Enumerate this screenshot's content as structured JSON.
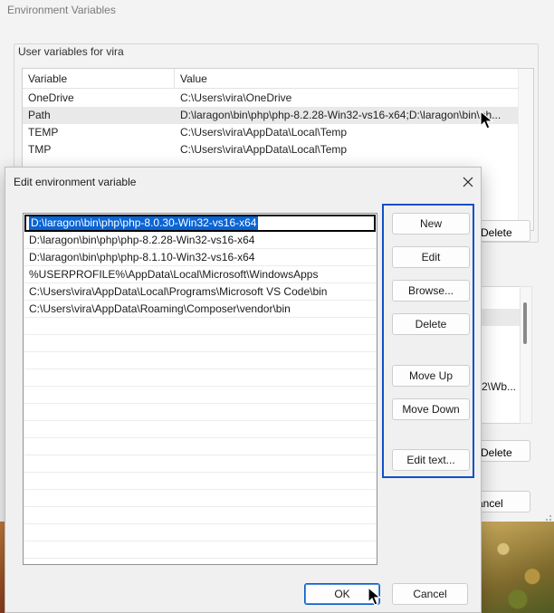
{
  "background_window": {
    "title": "Environment Variables",
    "user_group_label": "User variables for vira",
    "columns": [
      "Variable",
      "Value"
    ],
    "user_variables": [
      {
        "name": "OneDrive",
        "value": "C:\\Users\\vira\\OneDrive"
      },
      {
        "name": "Path",
        "value": "D:\\laragon\\bin\\php\\php-8.2.28-Win32-vs16-x64;D:\\laragon\\bin\\ph..."
      },
      {
        "name": "TEMP",
        "value": "C:\\Users\\vira\\AppData\\Local\\Temp"
      },
      {
        "name": "TMP",
        "value": "C:\\Users\\vira\\AppData\\Local\\Temp"
      }
    ],
    "selected_user_variable": "Path",
    "delete_label": "Delete",
    "system_partial_text": "2\\Wb...",
    "cancel_partial_label": "ancel"
  },
  "dialog": {
    "title": "Edit environment variable",
    "close_glyph": "✕",
    "paths": [
      "D:\\laragon\\bin\\php\\php-8.0.30-Win32-vs16-x64",
      "D:\\laragon\\bin\\php\\php-8.2.28-Win32-vs16-x64",
      "D:\\laragon\\bin\\php\\php-8.1.10-Win32-vs16-x64",
      "%USERPROFILE%\\AppData\\Local\\Microsoft\\WindowsApps",
      "C:\\Users\\vira\\AppData\\Local\\Programs\\Microsoft VS Code\\bin",
      "C:\\Users\\vira\\AppData\\Roaming\\Composer\\vendor\\bin"
    ],
    "selected_index": 0,
    "buttons": {
      "new": "New",
      "edit": "Edit",
      "browse": "Browse...",
      "delete": "Delete",
      "move_up": "Move Up",
      "move_down": "Move Down",
      "edit_text": "Edit text..."
    },
    "ok_label": "OK",
    "cancel_label": "Cancel",
    "highlight_color": "#0f50c8",
    "selection_color": "#0a64d4"
  },
  "icons": {
    "close": "close-icon",
    "cursor": "mouse-pointer-icon"
  }
}
